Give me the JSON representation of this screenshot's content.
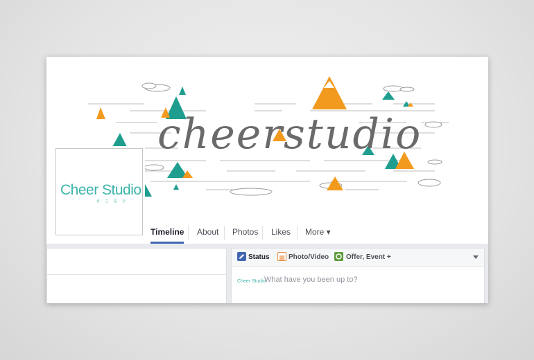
{
  "cover": {
    "title": "cheerstudio"
  },
  "profile": {
    "logo_text": "Cheer Studio",
    "logo_sub": "雀 之 設 計"
  },
  "nav": {
    "tabs": [
      {
        "label": "Timeline"
      },
      {
        "label": "About"
      },
      {
        "label": "Photos"
      },
      {
        "label": "Likes"
      },
      {
        "label": "More ▾"
      }
    ]
  },
  "composer": {
    "tabs": [
      {
        "label": "Status",
        "icon": "pencil-icon"
      },
      {
        "label": "Photo/Video",
        "icon": "photo-icon"
      },
      {
        "label": "Offer, Event +",
        "icon": "offer-icon"
      }
    ],
    "mini_logo": "Cheer Studio",
    "placeholder": "What have you been up to?"
  },
  "colors": {
    "accent_teal": "#1f9e8f",
    "accent_orange": "#f29a1e",
    "facebook_blue": "#4267b2"
  }
}
